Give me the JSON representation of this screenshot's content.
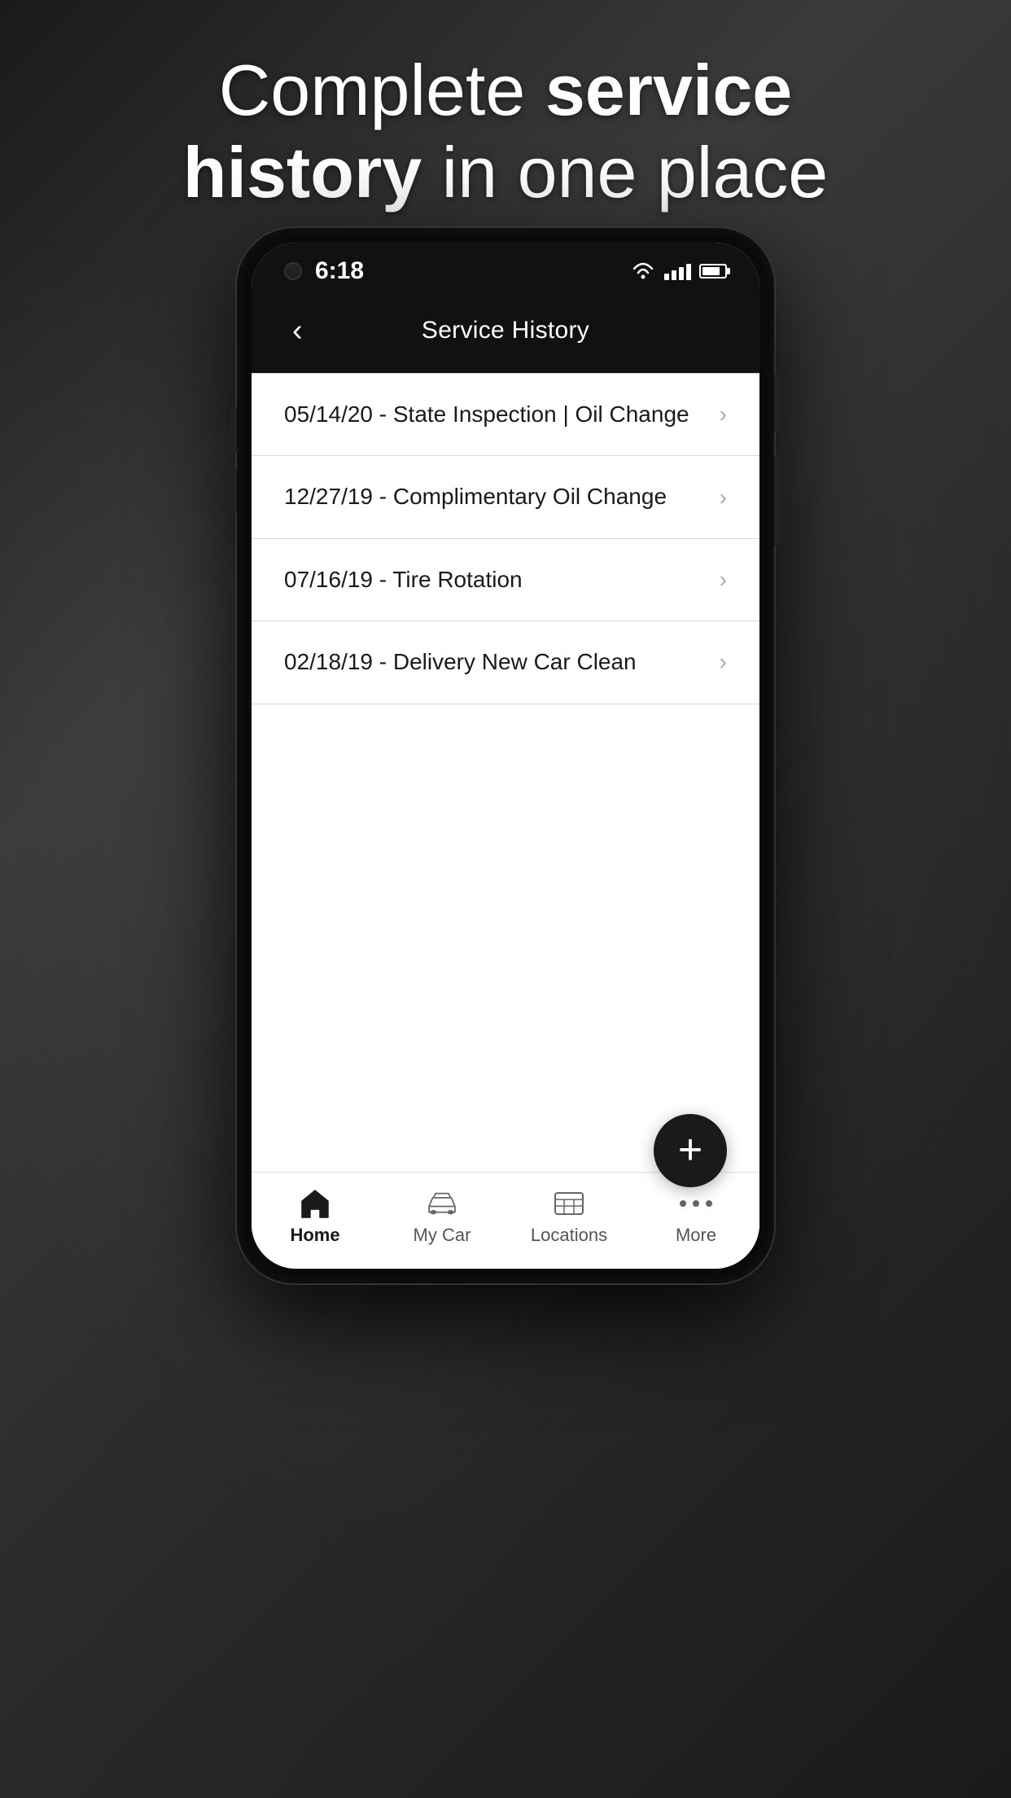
{
  "hero": {
    "line1": "Complete ",
    "line1_bold": "service",
    "line2_bold": "history",
    "line2": " in one place"
  },
  "status_bar": {
    "time": "6:18",
    "wifi": "wifi",
    "signal": "signal",
    "battery": "battery"
  },
  "header": {
    "back_label": "‹",
    "title": "Service History"
  },
  "service_items": [
    {
      "id": 1,
      "label": "05/14/20 - State Inspection | Oil Change"
    },
    {
      "id": 2,
      "label": "12/27/19 - Complimentary Oil Change"
    },
    {
      "id": 3,
      "label": "07/16/19 - Tire Rotation"
    },
    {
      "id": 4,
      "label": "02/18/19 - Delivery New Car Clean"
    }
  ],
  "fab": {
    "label": "+"
  },
  "bottom_nav": [
    {
      "id": "home",
      "label": "Home",
      "active": true
    },
    {
      "id": "my-car",
      "label": "My Car",
      "active": false
    },
    {
      "id": "locations",
      "label": "Locations",
      "active": false
    },
    {
      "id": "more",
      "label": "More",
      "active": false
    }
  ]
}
